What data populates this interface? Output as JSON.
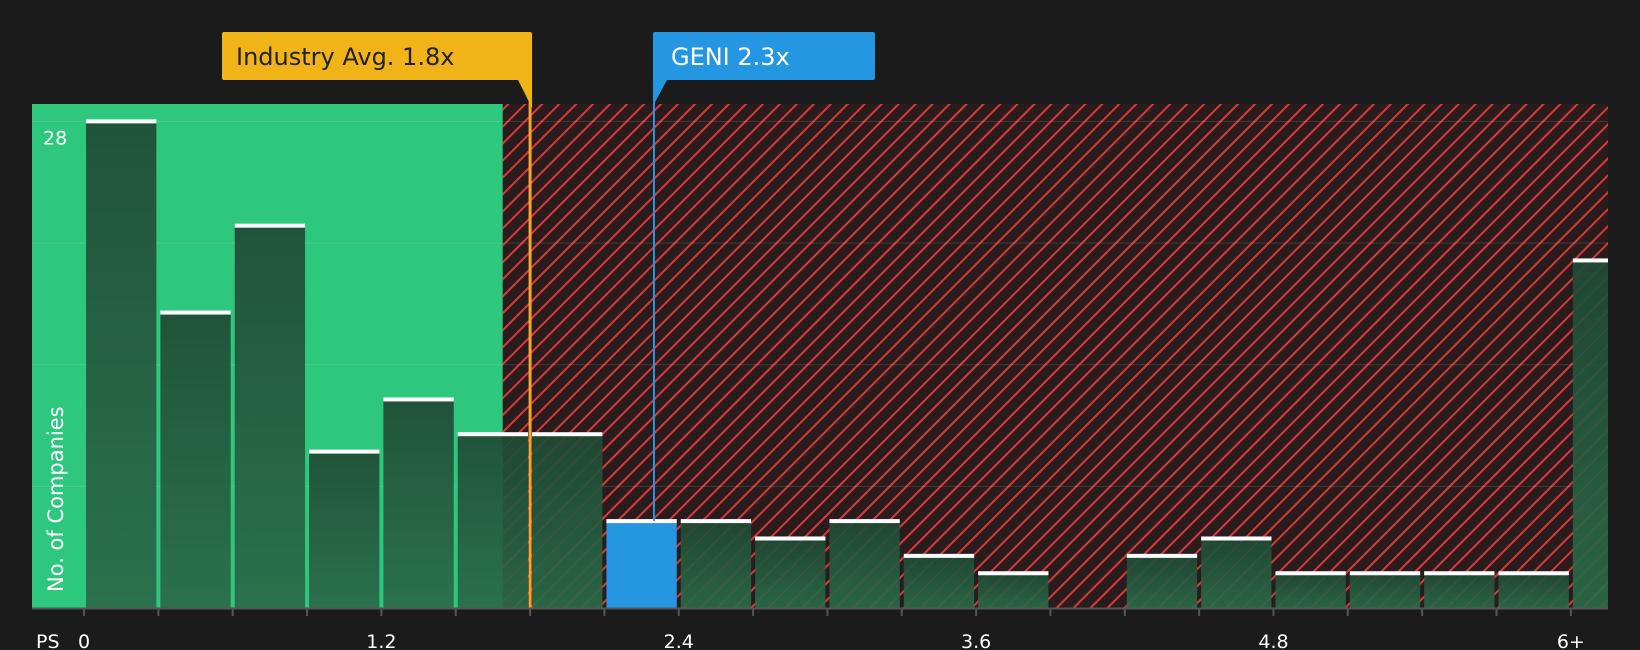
{
  "chart_data": {
    "type": "bar",
    "xlabel": "PS",
    "ylabel": "No. of Companies",
    "x_ticks": [
      "0",
      "1.2",
      "2.4",
      "3.6",
      "4.8",
      "6+"
    ],
    "x_tick_values": [
      0,
      1.2,
      2.4,
      3.6,
      4.8,
      6.0
    ],
    "y_ticks": [
      "28"
    ],
    "y_tick_values": [
      28
    ],
    "ylim": [
      0,
      29
    ],
    "xlim": [
      -0.21,
      6.15
    ],
    "bin_width": 0.3,
    "bins": [
      {
        "start": 0.0,
        "count": 28
      },
      {
        "start": 0.3,
        "count": 17
      },
      {
        "start": 0.6,
        "count": 22
      },
      {
        "start": 0.9,
        "count": 9
      },
      {
        "start": 1.2,
        "count": 12
      },
      {
        "start": 1.5,
        "count": 10
      },
      {
        "start": 1.8,
        "count": 10
      },
      {
        "start": 2.1,
        "count": 5,
        "highlight": true
      },
      {
        "start": 2.4,
        "count": 5
      },
      {
        "start": 2.7,
        "count": 4
      },
      {
        "start": 3.0,
        "count": 5
      },
      {
        "start": 3.3,
        "count": 3
      },
      {
        "start": 3.6,
        "count": 2
      },
      {
        "start": 3.9,
        "count": 0
      },
      {
        "start": 4.2,
        "count": 3
      },
      {
        "start": 4.5,
        "count": 4
      },
      {
        "start": 4.8,
        "count": 2
      },
      {
        "start": 5.1,
        "count": 2
      },
      {
        "start": 5.4,
        "count": 2
      },
      {
        "start": 5.7,
        "count": 2
      },
      {
        "start": 6.0,
        "count": 20
      }
    ],
    "fair_range_end": 1.69,
    "industry_avg": {
      "label": "Industry Avg. 1.8x",
      "value": 1.8
    },
    "company": {
      "label": "GENI 2.3x",
      "value": 2.3
    },
    "grid": true,
    "colors": {
      "background": "#1b1b1b",
      "fair_zone": "#2ec77e",
      "bar_dark": "#1f4a34",
      "bar_dark_light": "#2a6a48",
      "hatch_bg": "#2a1c1c",
      "hatch_line": "#d63a3a",
      "highlight_bar": "#2596e1",
      "industry_color": "#f0b418",
      "industry_line": "#f5a52a",
      "company_color": "#2596e1",
      "bar_cap": "#ffffff",
      "axis": "#555555",
      "text": "#ffffff",
      "callout_dark_text": "#222222"
    }
  }
}
